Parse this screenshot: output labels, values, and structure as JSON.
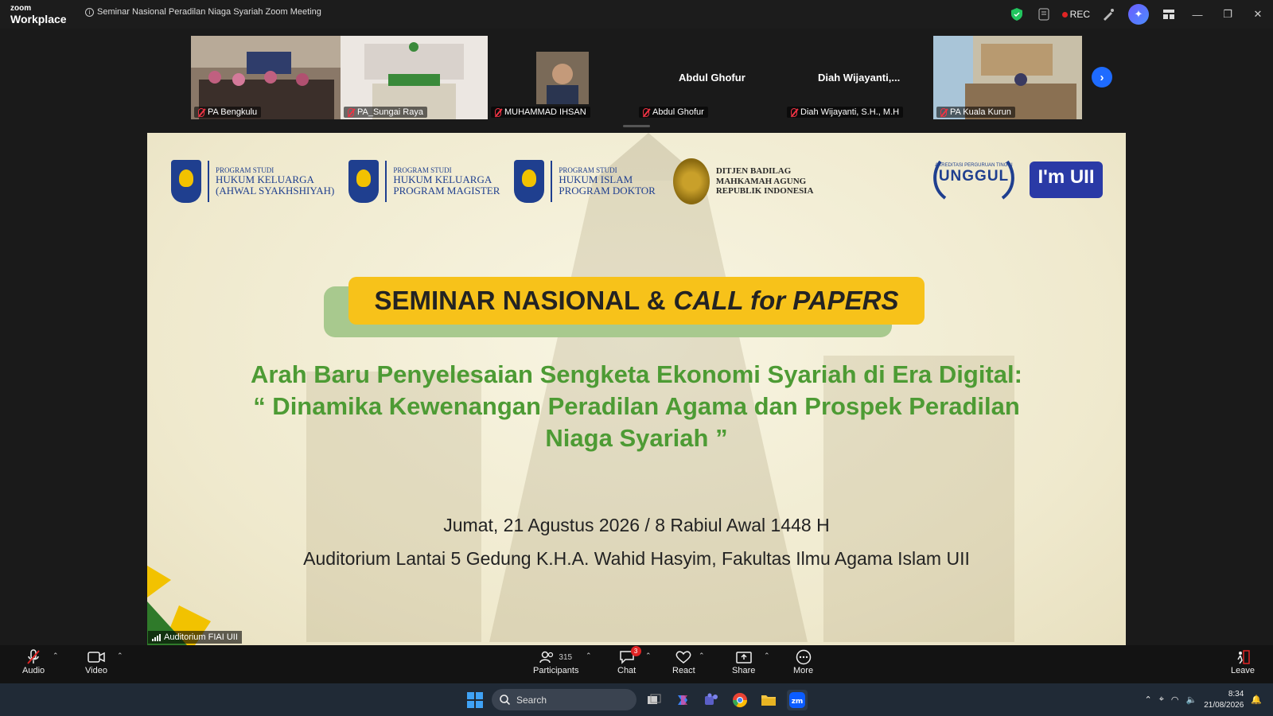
{
  "app": {
    "logo_small": "zoom",
    "logo_big": "Workplace",
    "meeting_title": "Seminar Nasional Peradilan Niaga Syariah Zoom Meeting"
  },
  "titlebar": {
    "rec_label": "REC",
    "colors": {
      "shield": "#22c55e",
      "rec": "#e02424",
      "accent": "#1e6bff"
    }
  },
  "participants_strip": [
    {
      "name": "PA Bengkulu",
      "muted": true,
      "video": true
    },
    {
      "name": "PA_Sungai Raya",
      "muted": true,
      "video": true
    },
    {
      "name": "MUHAMMAD IHSAN",
      "muted": true,
      "video": true
    },
    {
      "name": "Abdul Ghofur",
      "display": "Abdul Ghofur",
      "muted": true,
      "video": false
    },
    {
      "name": "Diah Wijayanti, S.H., M.H",
      "display": "Diah  Wijayanti,...",
      "muted": true,
      "video": false
    },
    {
      "name": "PA Kuala Kurun",
      "muted": true,
      "video": true
    }
  ],
  "slide": {
    "logos": {
      "prodi1": {
        "small": "PROGRAM STUDI",
        "l1": "HUKUM KELUARGA",
        "l2": "(AHWAL SYAKHSHIYAH)"
      },
      "prodi2": {
        "small": "PROGRAM STUDI",
        "l1": "HUKUM KELUARGA",
        "l2": "PROGRAM MAGISTER"
      },
      "prodi3": {
        "small": "PROGRAM STUDI",
        "l1": "HUKUM ISLAM",
        "l2": "PROGRAM DOKTOR"
      },
      "badilag": {
        "l1": "DITJEN BADILAG",
        "l2": "MAHKAMAH AGUNG",
        "l3": "REPUBLIK INDONESIA"
      },
      "akreditasi": {
        "small": "AKREDITASI PERGURUAN TINGGI",
        "big": "UNGGUL"
      },
      "imuii": "I'm UII"
    },
    "banner_a": "SEMINAR NASIONAL &",
    "banner_b": "CALL for PAPERS",
    "subtitle_l1": "Arah Baru Penyelesaian Sengketa Ekonomi Syariah di Era Digital:",
    "subtitle_l2": "“ Dinamika Kewenangan Peradilan Agama dan Prospek Peradilan",
    "subtitle_l3": "Niaga Syariah ”",
    "date": "Jumat, 21 Agustus 2026 / 8 Rabiul Awal 1448 H",
    "venue": "Auditorium Lantai 5 Gedung K.H.A. Wahid Hasyim, Fakultas Ilmu Agama Islam UII"
  },
  "active_speaker": "Auditorium FIAI UII",
  "controls": {
    "audio": "Audio",
    "video": "Video",
    "participants": "Participants",
    "participants_count": "315",
    "chat": "Chat",
    "chat_badge": "3",
    "react": "React",
    "share": "Share",
    "more": "More",
    "leave": "Leave"
  },
  "taskbar": {
    "search_placeholder": "Search",
    "time": "8:34",
    "date": "21/08/2026"
  }
}
